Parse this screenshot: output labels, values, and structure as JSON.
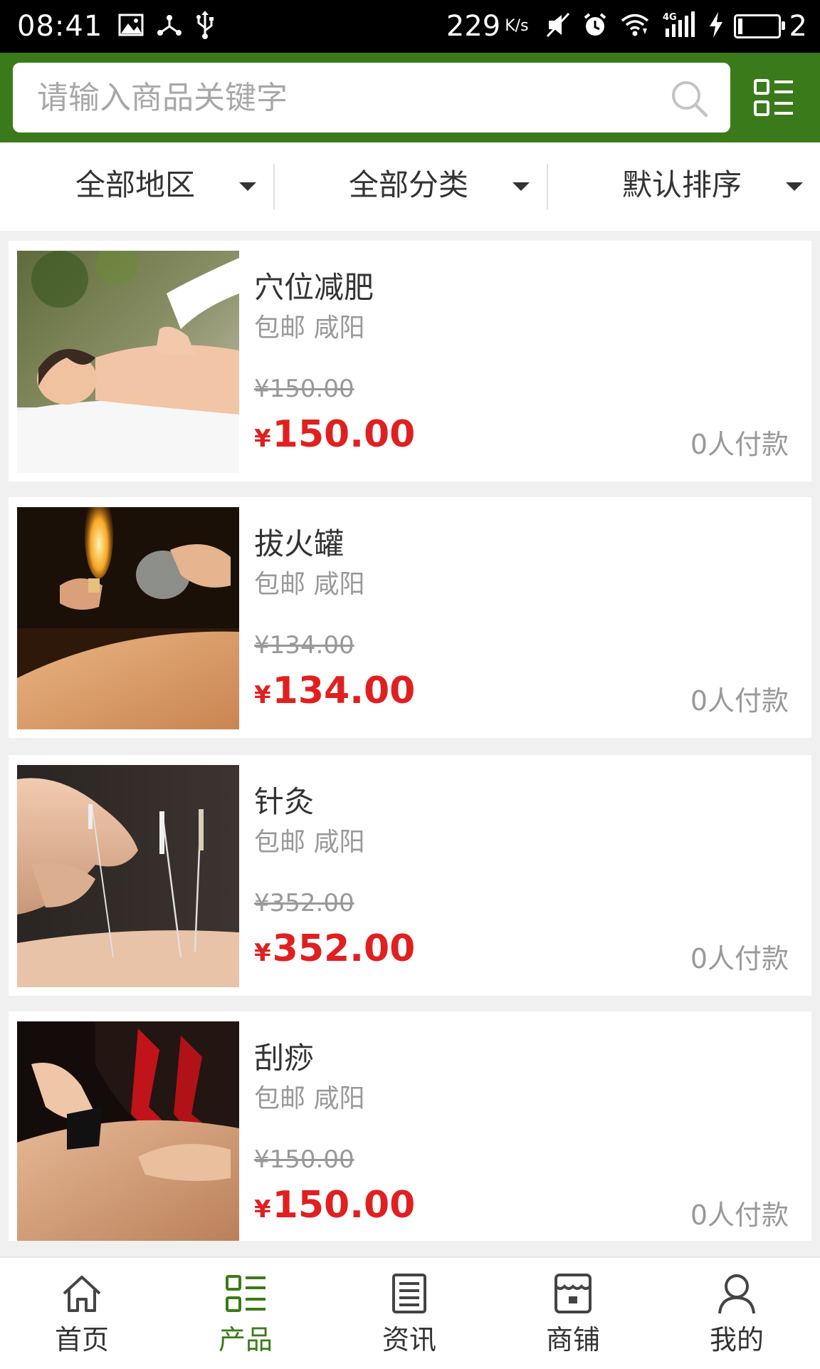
{
  "status_bar": {
    "time": "08:41",
    "net_speed": "229",
    "net_speed_unit": "K/s",
    "battery_level": "2",
    "icons": [
      "image-icon",
      "share-icon",
      "usb-icon",
      "mute-icon",
      "alarm-icon",
      "wifi-icon",
      "signal-4g-icon",
      "charging-icon",
      "battery-icon"
    ]
  },
  "search": {
    "placeholder": "请输入商品关键字",
    "value": ""
  },
  "filters": [
    {
      "label": "全部地区"
    },
    {
      "label": "全部分类"
    },
    {
      "label": "默认排序"
    }
  ],
  "products": [
    {
      "title": "穴位减肥",
      "subtitle": "包邮 咸阳",
      "old_price": "¥150.00",
      "currency": "¥",
      "price": "150.00",
      "paid": "0人付款",
      "image": "back-massage-photo"
    },
    {
      "title": "拔火罐",
      "subtitle": "包邮 咸阳",
      "old_price": "¥134.00",
      "currency": "¥",
      "price": "134.00",
      "paid": "0人付款",
      "image": "fire-cupping-photo"
    },
    {
      "title": "针灸",
      "subtitle": "包邮 咸阳",
      "old_price": "¥352.00",
      "currency": "¥",
      "price": "352.00",
      "paid": "0人付款",
      "image": "acupuncture-photo"
    },
    {
      "title": "刮痧",
      "subtitle": "包邮 咸阳",
      "old_price": "¥150.00",
      "currency": "¥",
      "price": "150.00",
      "paid": "0人付款",
      "image": "gua-sha-photo"
    }
  ],
  "bottom_nav": [
    {
      "label": "首页",
      "icon": "home-icon",
      "active": false
    },
    {
      "label": "产品",
      "icon": "grid-list-icon",
      "active": true
    },
    {
      "label": "资讯",
      "icon": "document-icon",
      "active": false
    },
    {
      "label": "商铺",
      "icon": "store-icon",
      "active": false
    },
    {
      "label": "我的",
      "icon": "user-icon",
      "active": false
    }
  ],
  "colors": {
    "brand_green": "#3b7a1a",
    "price_red": "#e02020",
    "muted_text": "#999999"
  }
}
